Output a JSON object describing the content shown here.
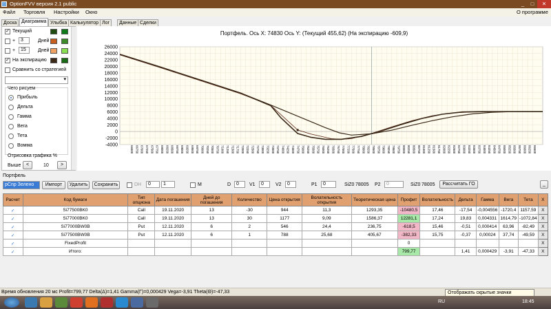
{
  "window": {
    "title": "OptionFVV версия 2.1 public",
    "minimize": "_",
    "maximize": "□",
    "close": "✕"
  },
  "menu": {
    "items": [
      "Файл",
      "Торговля",
      "Настройки",
      "Окно"
    ],
    "about": "О программе"
  },
  "tabs": [
    "Доска",
    "Диаграмма",
    "Улыбка",
    "Калькулятор",
    "Лог",
    "Данные",
    "Сделки"
  ],
  "left": {
    "current": "Текущий",
    "plus1": "+",
    "days1": "3",
    "days1_label": "Дней",
    "plus2": "+",
    "days2": "15",
    "days2_label": "Дней",
    "expiration": "На экспирацию",
    "compare": "Сравнить со стратегией",
    "draw_title": "Чего рисуем",
    "radios": [
      "Прибыль",
      "Дельта",
      "Гамма",
      "Вега",
      "Тета",
      "Вомма"
    ],
    "range_label": "Отрисовка графика %",
    "above_label": "Выше",
    "above_value": "10",
    "prev": "<",
    "next": ">",
    "colors": {
      "current": [
        "#1f4a10",
        "#0f7a1a"
      ],
      "d3": [
        "#c85e1e",
        "#3c8a28"
      ],
      "d15": [
        "#f0a060",
        "#88e050"
      ],
      "exp": [
        "#3a2818",
        "#1a6a18"
      ]
    }
  },
  "chart_data": {
    "type": "line",
    "title": "Портфель. Ось X: 74830 Ось Y:  (Текущий 455,62)  (На экспирацию -609,9)",
    "xlabel": "",
    "ylabel": "",
    "xlim": [
      66000,
      87000
    ],
    "ylim": [
      -4000,
      26000
    ],
    "yticks": [
      26000,
      24000,
      22000,
      20000,
      18000,
      16000,
      14000,
      12000,
      10000,
      8000,
      6000,
      4000,
      2000,
      0,
      -2000,
      -4000
    ],
    "xticks": [
      66500,
      66750,
      67000,
      67250,
      67500,
      67750,
      68000,
      68250,
      68500,
      68750,
      69000,
      69250,
      69500,
      69750,
      70000,
      70250,
      70500,
      70750,
      71000,
      71250,
      71500,
      71750,
      72000,
      72250,
      72500,
      72750,
      73000,
      73250,
      73500,
      73750,
      74000,
      74250,
      74500,
      74750,
      75000,
      75250,
      75500,
      75750,
      76000,
      76250,
      76500,
      76750,
      77000,
      77250,
      77500,
      77750,
      78000,
      78250,
      78500,
      78750,
      79000,
      79250,
      79500,
      79750,
      80000,
      80250,
      80500,
      80750,
      81000,
      81250,
      81500,
      81750,
      82000,
      82250,
      82500,
      82750,
      83000,
      83250,
      83500,
      83750,
      84000,
      84250,
      84500,
      84750,
      85000,
      85250,
      85500,
      85750,
      86000,
      86250,
      86500
    ],
    "grid": true,
    "cursor_x": 78500,
    "series": [
      {
        "color": "#3a2818",
        "points": [
          [
            66000,
            23700
          ],
          [
            68000,
            19800
          ],
          [
            70000,
            15800
          ],
          [
            72000,
            11800
          ],
          [
            73500,
            8100
          ],
          [
            74830,
            4700
          ],
          [
            75500,
            3000
          ],
          [
            76200,
            1200
          ],
          [
            76900,
            -400
          ],
          [
            77500,
            -1100
          ],
          [
            78500,
            -700
          ],
          [
            79500,
            400
          ],
          [
            80500,
            1900
          ],
          [
            81500,
            3300
          ],
          [
            82500,
            4500
          ],
          [
            83500,
            5400
          ],
          [
            84500,
            5900
          ],
          [
            85500,
            6100
          ],
          [
            87000,
            6100
          ]
        ]
      },
      {
        "color": "#5a2010",
        "points": [
          [
            66000,
            23500
          ],
          [
            68000,
            19600
          ],
          [
            70000,
            15600
          ],
          [
            72000,
            11600
          ],
          [
            73500,
            8000
          ],
          [
            74830,
            455.62
          ],
          [
            75500,
            -800
          ],
          [
            76500,
            -2200
          ],
          [
            77000,
            -2400
          ],
          [
            77500,
            -2200
          ],
          [
            78500,
            -600
          ],
          [
            79500,
            1400
          ],
          [
            80500,
            3300
          ],
          [
            81500,
            4800
          ],
          [
            82500,
            5700
          ],
          [
            83500,
            6000
          ],
          [
            85000,
            6100
          ],
          [
            87000,
            6100
          ]
        ]
      },
      {
        "color": "#3a2818",
        "points": [
          [
            66000,
            23700
          ],
          [
            68000,
            19800
          ],
          [
            70000,
            15800
          ],
          [
            72000,
            11800
          ],
          [
            73500,
            7900
          ],
          [
            74000,
            4200
          ],
          [
            74830,
            -609.9
          ],
          [
            75500,
            -1800
          ],
          [
            76200,
            -2400
          ],
          [
            77000,
            -2400
          ],
          [
            78000,
            -1500
          ],
          [
            79000,
            200
          ],
          [
            80000,
            2200
          ],
          [
            81000,
            4000
          ],
          [
            82000,
            5300
          ],
          [
            83000,
            6000
          ],
          [
            84000,
            6100
          ],
          [
            87000,
            6100
          ]
        ]
      }
    ]
  },
  "portfolio": {
    "label": "Портфель",
    "combo": "pCnp Зелено",
    "import": "Импорт",
    "delete": "Удалить",
    "save": "Сохранить",
    "dh": "DH",
    "dh_a": "0",
    "dh_b": "1",
    "m": "M",
    "d_label": "D",
    "d": "0",
    "v1_label": "V1",
    "v1": "0",
    "v2_label": "V2",
    "v2": "0",
    "p1_label": "P1",
    "p1": "0",
    "sizo1_label": "SiZ0",
    "sizo1": "78005",
    "p2_label": "P2",
    "p2": "0",
    "sizo2_label": "SiZ0",
    "sizo2": "78005",
    "calc_go": "Рассчитать ГО",
    "more": "_"
  },
  "table": {
    "headers": [
      "Расчет",
      "Код бумаги",
      "Тип опциона",
      "Дата погашения",
      "Дней до погашения",
      "Количество",
      "Цена открытия",
      "Волатильность открытия",
      "Теоретическая цена",
      "Профит",
      "Волатильность",
      "Дельта",
      "Гамма",
      "Вега",
      "Тета",
      "X"
    ],
    "rows": [
      {
        "chk": "✓",
        "code": "Si77500BK0",
        "type": "Call",
        "date": "19.11.2020",
        "days": "13",
        "qty": "-30",
        "price": "944",
        "vol_open": "11,3",
        "theo": "1293,35",
        "profit": "-10480,5",
        "pcls": "neg",
        "vol": "17,46",
        "delta": "-17,54",
        "gamma": "-0,004556",
        "vega": "-1720,4",
        "theta": "1157,59",
        "x": "X"
      },
      {
        "chk": "✓",
        "code": "Si77000BK0",
        "type": "Call",
        "date": "19.11.2020",
        "days": "13",
        "qty": "30",
        "price": "1177",
        "vol_open": "9,09",
        "theo": "1586,37",
        "profit": "12281,1",
        "pcls": "pos",
        "vol": "17,24",
        "delta": "19,83",
        "gamma": "0,004331",
        "vega": "1614,79",
        "theta": "-1072,84",
        "x": "X"
      },
      {
        "chk": "✓",
        "code": "Si77000BW0B",
        "type": "Put",
        "date": "12.11.2020",
        "days": "6",
        "qty": "2",
        "price": "546",
        "vol_open": "24,4",
        "theo": "236,75",
        "profit": "-618,5",
        "pcls": "neg",
        "vol": "15,46",
        "delta": "-0,51",
        "gamma": "0,000414",
        "vega": "63,96",
        "theta": "-82,49",
        "x": "X"
      },
      {
        "chk": "✓",
        "code": "Si77500BW0B",
        "type": "Put",
        "date": "12.11.2020",
        "days": "6",
        "qty": "1",
        "price": "788",
        "vol_open": "25,68",
        "theo": "405,67",
        "profit": "-382,33",
        "pcls": "neg",
        "vol": "15,75",
        "delta": "-0,37",
        "gamma": "0,00024",
        "vega": "37,74",
        "theta": "-49,59",
        "x": "X"
      },
      {
        "chk": "✓",
        "code": "FixedProfit",
        "type": "",
        "date": "",
        "days": "",
        "qty": "",
        "price": "",
        "vol_open": "",
        "theo": "",
        "profit": "0",
        "pcls": "",
        "vol": "",
        "delta": "",
        "gamma": "",
        "vega": "",
        "theta": "",
        "x": "X"
      },
      {
        "chk": "✓",
        "code": "Итого:",
        "type": "",
        "date": "",
        "days": "",
        "qty": "",
        "price": "",
        "vol_open": "",
        "theo": "",
        "profit": "799,77",
        "pcls": "pos",
        "vol": "",
        "delta": "1,41",
        "gamma": "0,000429",
        "vega": "-3,91",
        "theta": "-47,33",
        "x": "X"
      }
    ]
  },
  "status": "Время обновления 20 мс   Profit=799,77 Delta(Δ)=1,41 Gamma(Γ)=0,000429 Vega=-3,91 Theta(Θ)=-47,33",
  "tooltip": "Отображать скрытые значки",
  "taskbar": {
    "lang": "RU",
    "time": "18:45"
  }
}
